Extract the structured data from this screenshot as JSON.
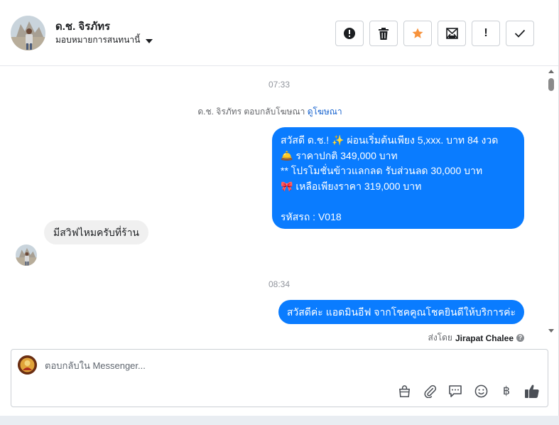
{
  "header": {
    "contact_name": "ด.ช. จิรภัทร",
    "assign_label": "มอบหมายการสนทนานี้",
    "actions": [
      {
        "icon": "alert-circle-icon",
        "label": "!"
      },
      {
        "icon": "trash-icon",
        "label": ""
      },
      {
        "icon": "star-icon",
        "label": ""
      },
      {
        "icon": "mark-unread-icon",
        "label": ""
      },
      {
        "icon": "exclamation-icon",
        "label": "!"
      },
      {
        "icon": "check-icon",
        "label": ""
      }
    ],
    "star_color": "#f7923b"
  },
  "conversation": {
    "timestamp_1": "07:33",
    "system_text": "ด.ช. จิรภัทร ตอบกลับโฆษณา",
    "system_link": "ดูโฆษณา",
    "outgoing_1_lines": [
      "สวัสดี ด.ช.! ✨ ผ่อนเริ่มต้นเพียง 5,xxx. บาท 84 งวด",
      "🛎️ ราคาปกติ 349,000 บาท",
      "** โปรโมชั่นข้าวแลกลด รับส่วนลด 30,000 บาท",
      "🎀 เหลือเพียงราคา 319,000 บาท",
      "",
      "รหัสรถ : V018"
    ],
    "incoming_1": "มีสวิฟไหมครับที่ร้าน",
    "timestamp_2": "08:34",
    "outgoing_2": "สวัสดีค่ะ แอดมินอีฟ จากโชคคูณโชคยินดีให้บริการค่ะ",
    "sent_by_prefix": "ส่งโดย",
    "sent_by_name": "Jirapat Chalee",
    "bubble_color": "#0a7cff"
  },
  "composer": {
    "placeholder": "ตอบกลับใน Messenger...",
    "tools": [
      "shopping-bag-icon",
      "attachment-icon",
      "saved-reply-icon",
      "emoji-icon",
      "baht-icon",
      "thumbs-up-icon"
    ],
    "baht_symbol": "฿"
  }
}
